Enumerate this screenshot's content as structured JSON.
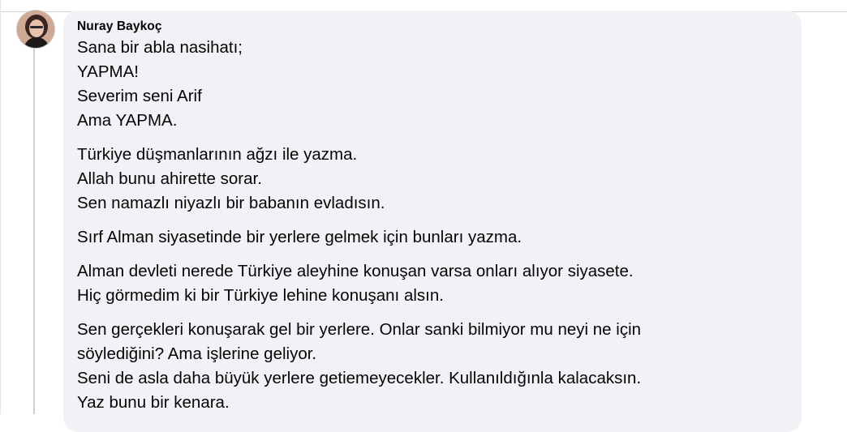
{
  "comment": {
    "author": "Nuray Baykoç",
    "paragraphs": [
      [
        "Sana bir abla nasihatı;",
        "YAPMA!",
        "Severim seni Arif",
        "Ama YAPMA."
      ],
      [
        "Türkiye düşmanlarının ağzı ile yazma.",
        "Allah bunu ahirette sorar.",
        "Sen namazlı niyazlı bir babanın evladısın."
      ],
      [
        "Sırf Alman siyasetinde bir yerlere gelmek için bunları yazma."
      ],
      [
        "Alman devleti nerede Türkiye aleyhine konuşan varsa onları alıyor siyasete.",
        "Hiç görmedim ki bir Türkiye lehine konuşanı alsın."
      ],
      [
        "Sen gerçekleri konuşarak gel bir yerlere. Onlar sanki bilmiyor mu neyi ne için",
        "söylediğini? Ama işlerine geliyor.",
        "Seni de asla daha büyük yerlere getiemeyecekler. Kullanıldığınla kalacaksın.",
        "Yaz bunu bir kenara."
      ]
    ]
  },
  "colors": {
    "bubble": "#f0f2f5",
    "text": "#050505",
    "divider": "#ced0d4"
  },
  "icons": {
    "avatar": "profile-photo"
  }
}
